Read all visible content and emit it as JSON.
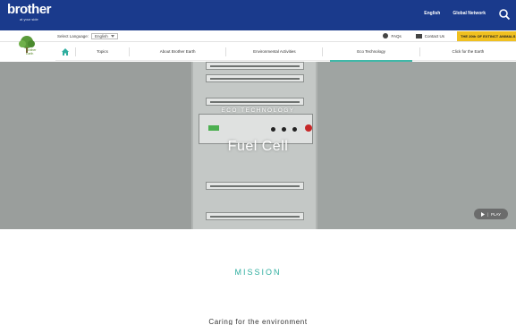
{
  "header": {
    "brand": "brother",
    "brand_tag": "at your side",
    "links": [
      "English",
      "Global Network"
    ]
  },
  "subbar": {
    "language_label": "Select Language:",
    "language_value": "English",
    "faq": "FAQs",
    "contact": "Contact Us",
    "banner": "THE 20th OF EXTINCT ANIMALS"
  },
  "logo": {
    "text_line1": "Brother",
    "text_line2": "Earth"
  },
  "nav": {
    "items": [
      "Topics",
      "About Brother Earth",
      "Environmental Activities",
      "Eco Technology",
      "Click for the Earth"
    ],
    "active_index": 3
  },
  "hero": {
    "kicker": "ECO TECHNOLOGY",
    "title": "Fuel Cell",
    "play_label": "PLAY"
  },
  "main": {
    "mission_heading": "MISSION",
    "subheading": "Caring for the environment"
  },
  "colors": {
    "topbar": "#1a3a8c",
    "accent": "#2fae9f",
    "banner": "#f0c020"
  }
}
